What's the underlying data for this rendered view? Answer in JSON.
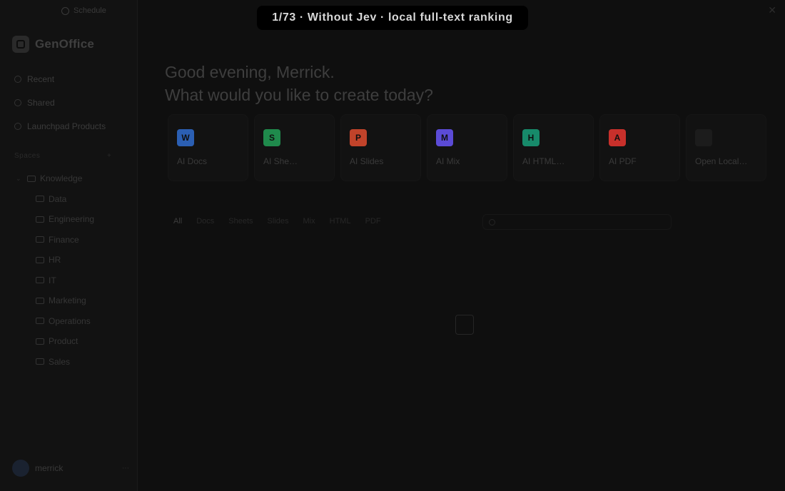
{
  "overlay": {
    "banner": "1/73 · Without Jev · local full-text ranking"
  },
  "topbar": {
    "search_label": "Schedule"
  },
  "brand": {
    "name": "GenOffice"
  },
  "nav": [
    {
      "label": "Recent",
      "end": ""
    },
    {
      "label": "Shared",
      "end": ""
    },
    {
      "label": "Launchpad Products",
      "end": ""
    }
  ],
  "tree": {
    "section_label": "Spaces",
    "section_actions": "+",
    "root": {
      "label": "Knowledge"
    },
    "children": [
      {
        "label": "Data"
      },
      {
        "label": "Engineering"
      },
      {
        "label": "Finance"
      },
      {
        "label": "HR"
      },
      {
        "label": "IT"
      },
      {
        "label": "Marketing"
      },
      {
        "label": "Operations"
      },
      {
        "label": "Product"
      },
      {
        "label": "Sales"
      }
    ]
  },
  "user": {
    "name": "merrick"
  },
  "greeting": {
    "line1": "Good evening, Merrick.",
    "line2": "What would you like to create today?"
  },
  "cards": [
    {
      "title": "AI Docs",
      "badge": "",
      "sub": "",
      "icon_letter": "W",
      "color": "#2b5fb3"
    },
    {
      "title": "AI She…",
      "badge": "",
      "sub": "",
      "icon_letter": "S",
      "color": "#1f8a4c"
    },
    {
      "title": "AI Slides",
      "badge": "",
      "sub": "",
      "icon_letter": "P",
      "color": "#c1432a"
    },
    {
      "title": "AI Mix",
      "badge": "",
      "sub": "",
      "icon_letter": "M",
      "color": "#5b4bd6"
    },
    {
      "title": "AI HTML…",
      "badge": "",
      "sub": "",
      "icon_letter": "H",
      "color": "#178a6a"
    },
    {
      "title": "AI PDF",
      "badge": "",
      "sub": "",
      "icon_letter": "A",
      "color": "#c8302b"
    },
    {
      "title": "Open Local…",
      "badge": "",
      "sub": "",
      "icon_letter": "",
      "color": "#2a2a2a"
    }
  ],
  "filters": [
    "All",
    "Docs",
    "Sheets",
    "Slides",
    "Mix",
    "HTML",
    "PDF"
  ],
  "search": {
    "placeholder": ""
  },
  "sort_label": "",
  "empty": {
    "text": ""
  }
}
